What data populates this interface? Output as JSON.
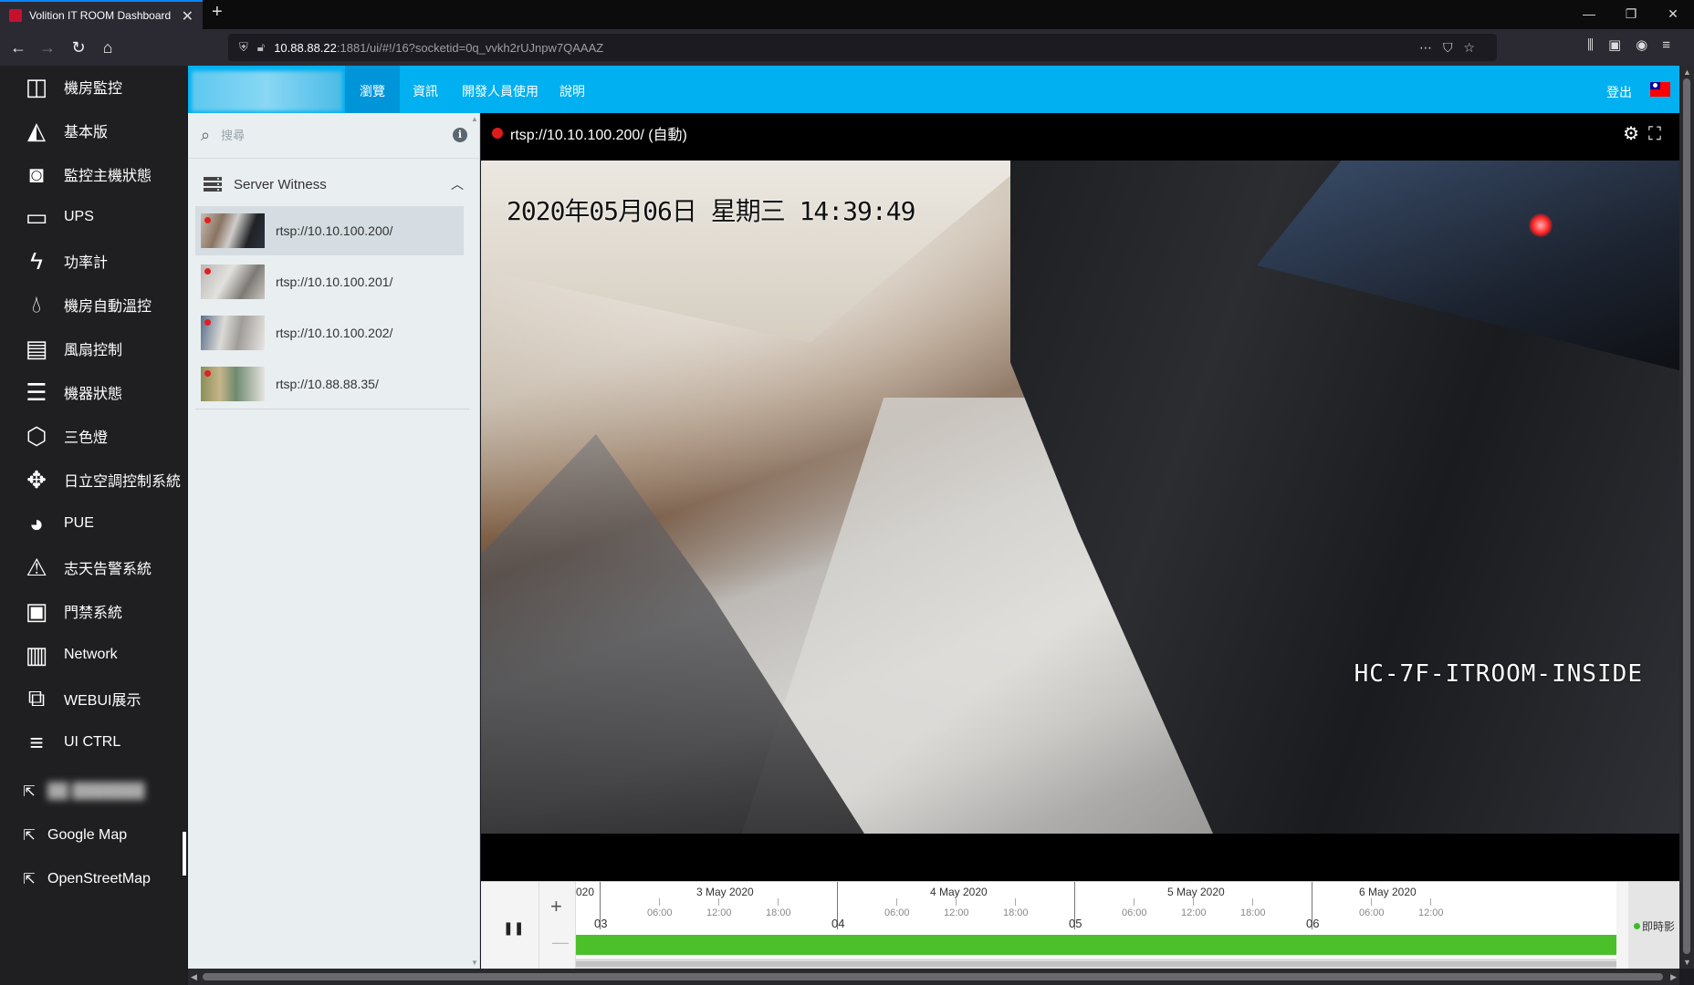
{
  "browser": {
    "tab_title": "Volition IT ROOM Dashboard",
    "tab_close": "✕",
    "new_tab": "+",
    "url_host": "10.88.88.22",
    "url_path": ":1881/ui/#!/16?socketid=0q_vvkh2rUJnpw7QAAAZ"
  },
  "sidebar": {
    "items": [
      {
        "label": "機房監控",
        "icon": "columns-icon"
      },
      {
        "label": "基本版",
        "icon": "area-chart-icon"
      },
      {
        "label": "監控主機狀態",
        "icon": "camera-icon"
      },
      {
        "label": "UPS",
        "icon": "battery-icon"
      },
      {
        "label": "功率計",
        "icon": "bolt-icon"
      },
      {
        "label": "機房自動溫控",
        "icon": "tint-icon"
      },
      {
        "label": "風扇控制",
        "icon": "sliders-icon"
      },
      {
        "label": "機器狀態",
        "icon": "server-icon"
      },
      {
        "label": "三色燈",
        "icon": "cube-icon"
      },
      {
        "label": "日立空調控制系統",
        "icon": "arrows-icon"
      },
      {
        "label": "PUE",
        "icon": "dashboard-icon"
      },
      {
        "label": "志天告警系統",
        "icon": "warning-icon"
      },
      {
        "label": "門禁系統",
        "icon": "id-card-icon"
      },
      {
        "label": "Network",
        "icon": "bar-chart-icon"
      },
      {
        "label": "WEBUI展示",
        "icon": "external-link-icon"
      },
      {
        "label": "UI CTRL",
        "icon": "bars-icon"
      }
    ],
    "links": [
      {
        "label": "██ ███████",
        "icon": "open-link-icon"
      },
      {
        "label": "Google Map",
        "icon": "open-link-icon"
      },
      {
        "label": "OpenStreetMap",
        "icon": "open-link-icon"
      }
    ]
  },
  "header": {
    "tabs": [
      "瀏覽",
      "資訊",
      "開發人員使用",
      "說明"
    ],
    "active_tab": 0,
    "logout": "登出"
  },
  "list": {
    "search_placeholder": "搜尋",
    "info": "i",
    "group": "Server Witness",
    "cameras": [
      {
        "label": "rtsp://10.10.100.200/",
        "selected": true
      },
      {
        "label": "rtsp://10.10.100.201/",
        "selected": false
      },
      {
        "label": "rtsp://10.10.100.202/",
        "selected": false
      },
      {
        "label": "rtsp://10.88.88.35/",
        "selected": false
      }
    ]
  },
  "video": {
    "title": "rtsp://10.10.100.200/ (自動)",
    "osd_time": "2020年05月06日 星期三 14:39:49",
    "osd_name": "HC-7F-ITROOM-INSIDE"
  },
  "timeline": {
    "left_partial": "020",
    "days": [
      {
        "label": "3 May 2020",
        "num": "03"
      },
      {
        "label": "4 May 2020",
        "num": "04"
      },
      {
        "label": "5 May 2020",
        "num": "05"
      },
      {
        "label": "6 May 2020",
        "num": "06"
      }
    ],
    "hours": [
      "06:00",
      "12:00",
      "18:00"
    ],
    "live_label": "即時影",
    "pause": "❚❚",
    "zoom_in": "+",
    "zoom_out": "—"
  },
  "colors": {
    "header": "#00b0f0",
    "sidebar": "#1f1f21",
    "recording": "#4bc02a"
  }
}
